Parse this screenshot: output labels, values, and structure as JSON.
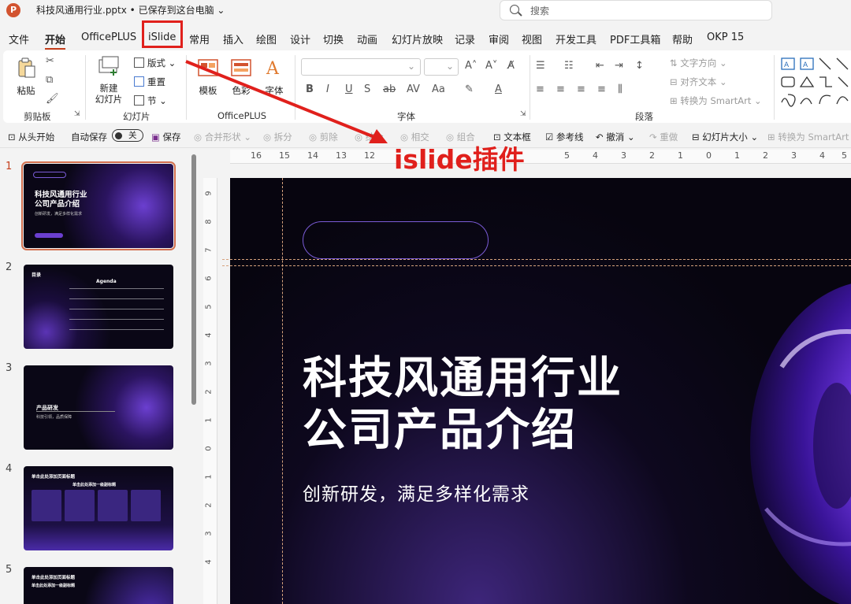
{
  "window": {
    "app_icon": "P",
    "title": "科技风通用行业.pptx • 已保存到这台电脑",
    "search_placeholder": "搜索"
  },
  "menu_tabs": [
    "文件",
    "开始",
    "OfficePLUS",
    "iSlide",
    "常用",
    "插入",
    "绘图",
    "设计",
    "切换",
    "动画",
    "幻灯片放映",
    "记录",
    "审阅",
    "视图",
    "开发工具",
    "PDF工具箱",
    "帮助",
    "OKP 15"
  ],
  "active_tab": "开始",
  "ribbon": {
    "clipboard": {
      "paste": "粘贴",
      "group_label": "剪贴板"
    },
    "slides": {
      "new_slide": "新建\n幻灯片",
      "layout": "版式",
      "reset": "重置",
      "section": "节",
      "group_label": "幻灯片"
    },
    "officeplus": {
      "template": "模板",
      "color": "色彩",
      "font": "字体",
      "group_label": "OfficePLUS"
    },
    "font": {
      "group_label": "字体"
    },
    "paragraph": {
      "text_direction": "文字方向",
      "align_text": "对齐文本",
      "convert_smartart": "转换为 SmartArt",
      "group_label": "段落"
    }
  },
  "quick_access": [
    "从头开始",
    "自动保存",
    "关",
    "保存",
    "合并形状",
    "拆分",
    "剪除",
    "结合",
    "相交",
    "组合",
    "文本框",
    "参考线",
    "撤消",
    "重做",
    "幻灯片大小",
    "转换为 SmartArt"
  ],
  "thumbnails": [
    {
      "num": "1",
      "title": "科技风通用行业\n公司产品介绍",
      "subtitle": "创新研发，满足多样化需求"
    },
    {
      "num": "2",
      "title": "目录",
      "subtitle": "Agenda"
    },
    {
      "num": "3",
      "title": "产品研发",
      "subtitle": "科技引领，品质保障"
    },
    {
      "num": "4",
      "title": "单击此处添加页面标题",
      "subtitle": "单击此处添加一级副标题"
    },
    {
      "num": "5",
      "title": "单击此处添加页面标题",
      "subtitle": "单击此处添加一级副标题"
    }
  ],
  "ruler": {
    "horizontal": [
      "16",
      "15",
      "14",
      "13",
      "12",
      "5",
      "4",
      "3",
      "2",
      "1",
      "0",
      "1",
      "2",
      "3",
      "4",
      "5"
    ],
    "vertical": [
      "9",
      "8",
      "7",
      "6",
      "5",
      "4",
      "3",
      "2",
      "1",
      "0",
      "1",
      "2",
      "3",
      "4"
    ]
  },
  "slide": {
    "title_line1": "科技风通用行业",
    "title_line2": "公司产品介绍",
    "subtitle": "创新研发，满足多样化需求"
  },
  "annotation": {
    "text": "islide插件",
    "color": "#e0201c"
  },
  "colors": {
    "accent": "#c43e1c",
    "annotation_red": "#e0201c",
    "slide_bg": "#07050f",
    "purple": "#7a5bd6"
  }
}
